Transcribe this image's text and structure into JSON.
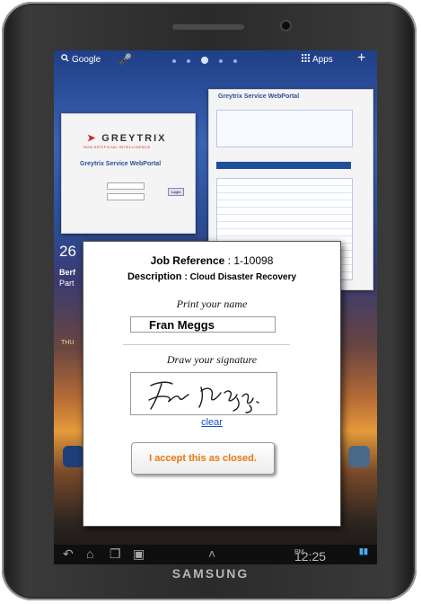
{
  "device": {
    "brand": "SAMSUNG"
  },
  "statusbar": {
    "search_label": "Google",
    "apps_label": "Apps",
    "plus_label": "+"
  },
  "background_thumbnails": {
    "thumb1": {
      "logo": "GREYTRIX",
      "tagline": "NON ARTIFICIAL INTELLIGENCE",
      "title": "Greytrix Service WebPortal",
      "login_label": "Login"
    },
    "thumb2": {
      "title": "Greytrix Service WebPortal"
    }
  },
  "homescreen": {
    "left_number": "26",
    "left_text_1": "Berf",
    "left_text_2": "Part",
    "weekday": "THU"
  },
  "dialog": {
    "job_reference_label": "Job Reference",
    "job_reference_value": ": 1-10098",
    "description_label": "Description",
    "description_value": ": Cloud Disaster Recovery",
    "print_name_label": "Print your name",
    "name_value": "Fran Meggs",
    "draw_signature_label": "Draw your signature",
    "clear_label": "clear",
    "accept_label": "I accept this as closed."
  },
  "navbar": {
    "time": "12:25",
    "ampm": "PM"
  },
  "colors": {
    "accept_text": "#e87810",
    "link": "#1a4fc8",
    "portal_blue": "#2b4f9a"
  }
}
